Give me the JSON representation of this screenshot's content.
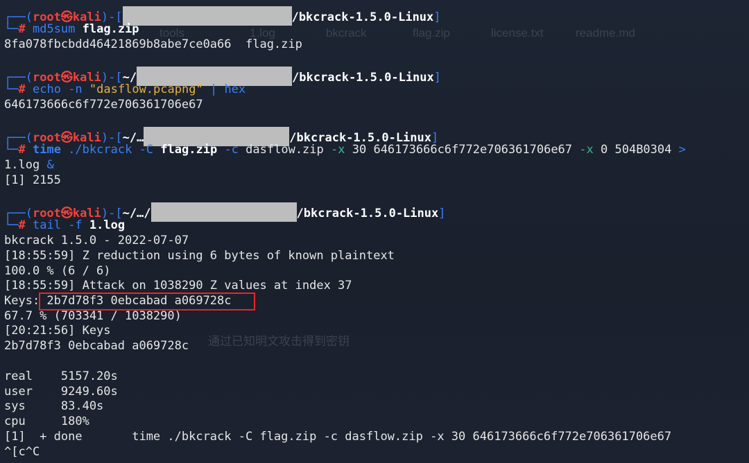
{
  "terminal": {
    "prompt": {
      "open": "┌──(",
      "user": "root",
      "at": "㉿",
      "host": "kali",
      "close": ")-[",
      "home": "~/",
      "home_trunc": "~/…",
      "home_trunc2": "~/…/",
      "dir": "/bkcrack-1.5.0-Linux",
      "end": "]",
      "corner": "└─",
      "hash": "#"
    },
    "blocks": [
      {
        "cmd": "md5sum",
        "arg": "flag.zip",
        "output": [
          "8fa078fbcbdd46421869b8abe7ce0a66  flag.zip"
        ]
      },
      {
        "cmd": "echo",
        "opt": "-n",
        "str": "\"dasflow.pcapng\"",
        "pipe": "|",
        "cmd2": "hex",
        "output": [
          "646173666c6f772e706361706e67"
        ]
      },
      {
        "kw": "time",
        "cmd": "./bkcrack",
        "opt1": "-C",
        "arg1": "flag.zip",
        "opt2": "-c",
        "arg2": "dasflow.zip",
        "opt3": "-x",
        "arg3": "30 646173666c6f772e706361706e67",
        "opt4": "-x",
        "arg4": "0 504B0304",
        "redirect": ">",
        "wrap": "1.log",
        "bg": "&",
        "output": [
          "[1] 2155"
        ]
      },
      {
        "cmd": "tail",
        "opt": "-f",
        "arg": "1.log",
        "output": [
          "bkcrack 1.5.0 - 2022-07-07",
          "[18:55:59] Z reduction using 6 bytes of known plaintext",
          "100.0 % (6 / 6)",
          "[18:55:59] Attack on 1038290 Z values at index 37",
          "Keys: 2b7d78f3 0ebcabad a069728c",
          "67.7 % (703341 / 1038290)",
          "[20:21:56] Keys",
          "2b7d78f3 0ebcabad a069728c",
          "",
          "real    5157.20s",
          "user    9249.60s",
          "sys     83.40s",
          "cpu     180%",
          "[1]  + done       time ./bkcrack -C flag.zip -c dasflow.zip -x 30 646173666c6f772e706361706e67",
          "^[c^C"
        ]
      }
    ],
    "ghost_labels": [
      "tools",
      "1.log",
      "bkcrack",
      "flag.zip",
      "license.txt",
      "readme.md"
    ],
    "ghost_caption": "通过已知明文攻击得到密钥"
  }
}
